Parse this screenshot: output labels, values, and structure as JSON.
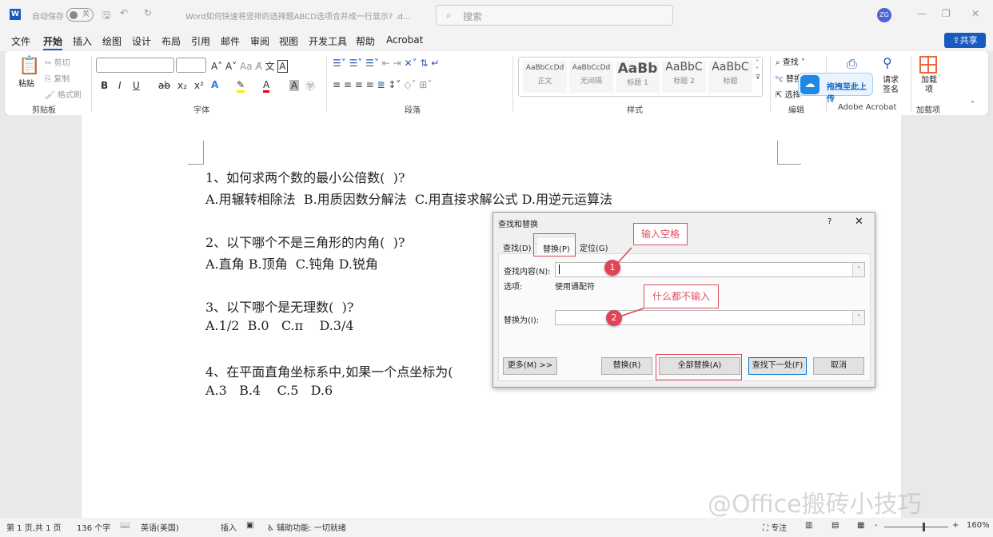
{
  "titlebar": {
    "autosave_label": "自动保存",
    "autosave_state": "关",
    "doc_title": "Word如何快速将竖排的选择题ABCD选项合并成一行显示? .d...",
    "search_placeholder": "搜索",
    "avatar": "ZG"
  },
  "menu": [
    "文件",
    "开始",
    "插入",
    "绘图",
    "设计",
    "布局",
    "引用",
    "邮件",
    "审阅",
    "视图",
    "开发工具",
    "帮助",
    "Acrobat"
  ],
  "share_label": "共享",
  "ribbon": {
    "clipboard": {
      "paste": "粘贴",
      "cut": "剪切",
      "copy": "复制",
      "format_painter": "格式刷",
      "group": "剪贴板"
    },
    "font": {
      "group": "字体"
    },
    "paragraph": {
      "group": "段落"
    },
    "styles": {
      "group": "样式",
      "items": [
        {
          "preview": "AaBbCcDd",
          "name": "正文"
        },
        {
          "preview": "AaBbCcDd",
          "name": "无间隔"
        },
        {
          "preview": "AaBb",
          "name": "标题 1"
        },
        {
          "preview": "AaBbC",
          "name": "标题 2"
        },
        {
          "preview": "AaBbC",
          "name": "标题"
        }
      ]
    },
    "editing": {
      "find": "查找",
      "replace": "替换",
      "select": "选择",
      "group": "编辑"
    },
    "acrobat": {
      "request_sign": "请求签名",
      "group": "Adobe Acrobat",
      "upload_popup": "拖拽至此上传"
    },
    "addins": {
      "label": "加载项",
      "group": "加载项"
    }
  },
  "document": {
    "lines": [
      "1、如何求两个数的最小公倍数(  )?",
      "A.用辗转相除法  B.用质因数分解法  C.用直接求解公式 D.用逆元运算法",
      "2、以下哪个不是三角形的内角(  )?",
      "A.直角 B.顶角  C.钝角 D.锐角",
      "3、以下哪个是无理数(  )?",
      "A.1/2  B.0   C.π    D.3/4",
      "4、在平面直角坐标系中,如果一个点坐标为(",
      "A.3   B.4    C.5   D.6"
    ]
  },
  "dialog": {
    "title": "查找和替换",
    "help": "?",
    "tabs": [
      "查找(D)",
      "替换(P)",
      "定位(G)"
    ],
    "find_label": "查找内容(N):",
    "find_value": "",
    "options_label": "选项:",
    "options_value": "使用通配符",
    "replace_label": "替换为(I):",
    "replace_value": "",
    "buttons": {
      "more": "更多(M) >>",
      "replace": "替换(R)",
      "replace_all": "全部替换(A)",
      "find_next": "查找下一处(F)",
      "cancel": "取消"
    }
  },
  "annotations": {
    "callout1": "输入空格",
    "callout2": "什么都不输入",
    "badge1": "1",
    "badge2": "2"
  },
  "statusbar": {
    "page": "第 1 页,共 1 页",
    "words": "136 个字",
    "language": "英语(美国)",
    "mode": "插入",
    "accessibility": "辅助功能: 一切就绪",
    "focus": "专注",
    "zoom": "160%"
  },
  "watermark": "@Office搬砖小技巧",
  "colors": {
    "accent": "#185abd",
    "annotation": "#e04456"
  }
}
